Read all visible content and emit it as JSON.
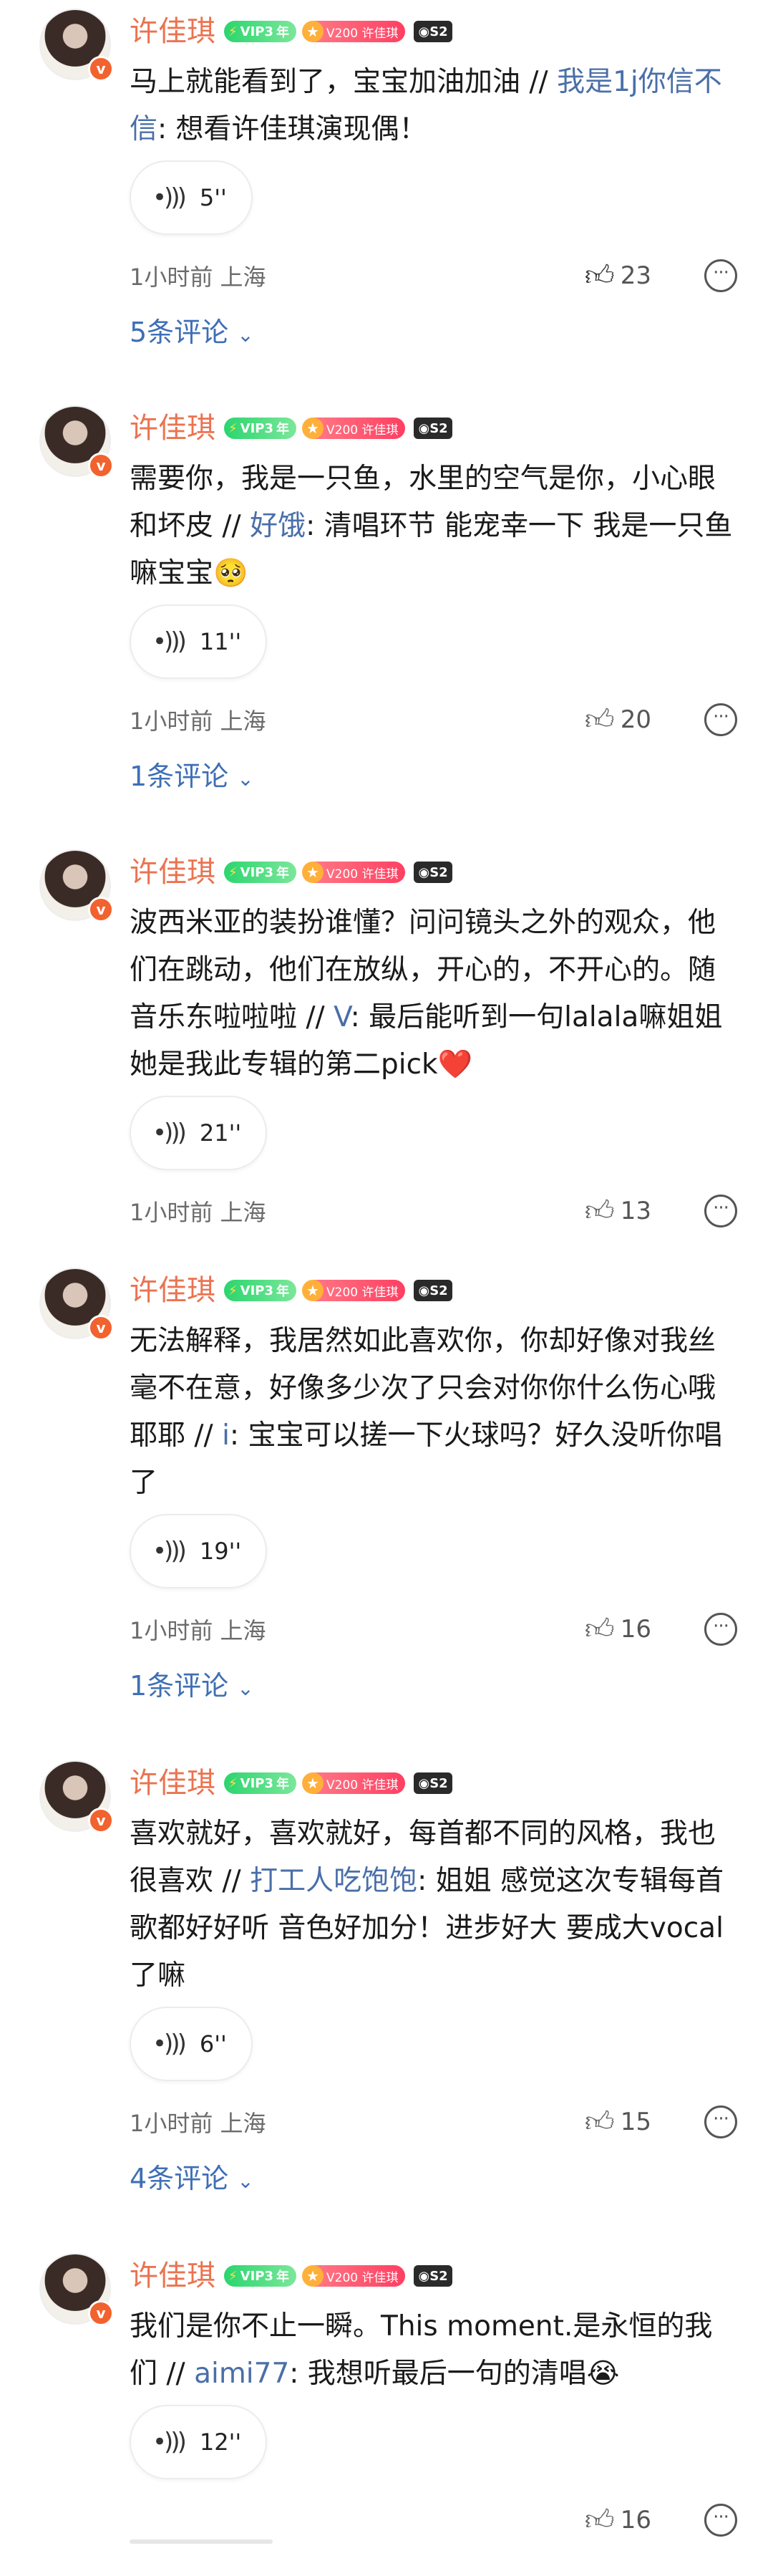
{
  "comments": [
    {
      "username": "许佳琪",
      "vip_label": "VIP3",
      "vip_year": "年",
      "fan_badge": "V200 许佳琪",
      "svip_label": "S2",
      "text_before": "马上就能看到了，宝宝加油加油 // ",
      "mention": "我是1j你信不信",
      "text_after": ": 想看许佳琪演现偶！",
      "voice_duration": "5''",
      "time_location": "1小时前 上海",
      "likes": "23",
      "liked": true,
      "replies": "5条评论"
    },
    {
      "username": "许佳琪",
      "vip_label": "VIP3",
      "vip_year": "年",
      "fan_badge": "V200 许佳琪",
      "svip_label": "S2",
      "text_before": "需要你，我是一只鱼，水里的空气是你，小心眼和坏皮 // ",
      "mention": "好饿",
      "text_after": ": 清唱环节 能宠幸一下 我是一只鱼嘛宝宝🥺",
      "voice_duration": "11''",
      "time_location": "1小时前 上海",
      "likes": "20",
      "liked": false,
      "replies": "1条评论"
    },
    {
      "username": "许佳琪",
      "vip_label": "VIP3",
      "vip_year": "年",
      "fan_badge": "V200 许佳琪",
      "svip_label": "S2",
      "text_before": "波西米亚的装扮谁懂？问问镜头之外的观众，他们在跳动，他们在放纵，开心的，不开心的。随音乐东啦啦啦 // ",
      "mention": "V",
      "text_after": ": 最后能听到一句lalala嘛姐姐 她是我此专辑的第二pick❤️",
      "voice_duration": "21''",
      "time_location": "1小时前 上海",
      "likes": "13",
      "liked": false,
      "replies": ""
    },
    {
      "username": "许佳琪",
      "vip_label": "VIP3",
      "vip_year": "年",
      "fan_badge": "V200 许佳琪",
      "svip_label": "S2",
      "text_before": "无法解释，我居然如此喜欢你，你却好像对我丝毫不在意，好像多少次了只会对你你什么伤心哦耶耶 // ",
      "mention": "i",
      "text_after": ": 宝宝可以搓一下火球吗？好久没听你唱了",
      "voice_duration": "19''",
      "time_location": "1小时前 上海",
      "likes": "16",
      "liked": false,
      "replies": "1条评论"
    },
    {
      "username": "许佳琪",
      "vip_label": "VIP3",
      "vip_year": "年",
      "fan_badge": "V200 许佳琪",
      "svip_label": "S2",
      "text_before": "喜欢就好，喜欢就好，每首都不同的风格，我也很喜欢 // ",
      "mention": "打工人吃饱饱",
      "text_after": ": 姐姐 感觉这次专辑每首歌都好好听 音色好加分！进步好大 要成大vocal了嘛",
      "voice_duration": "6''",
      "time_location": "1小时前 上海",
      "likes": "15",
      "liked": false,
      "replies": "4条评论"
    },
    {
      "username": "许佳琪",
      "vip_label": "VIP3",
      "vip_year": "年",
      "fan_badge": "V200 许佳琪",
      "svip_label": "S2",
      "text_before": "我们是你不止一瞬。This moment.是永恒的我们 // ",
      "mention": "aimi77",
      "text_after": ": 我想听最后一句的清唱😭",
      "voice_duration": "12''",
      "time_location": "",
      "likes": "16",
      "liked": false,
      "replies": ""
    }
  ],
  "icons": {
    "voice": "sound-wave-icon",
    "like": "thumbs-up-icon",
    "more": "more-options-icon",
    "chevron": "chevron-down-icon"
  },
  "colors": {
    "username": "#eb7350",
    "link": "#3f6fb5",
    "vip": "#2bd56e",
    "fan_badge": "#ff3f62"
  }
}
